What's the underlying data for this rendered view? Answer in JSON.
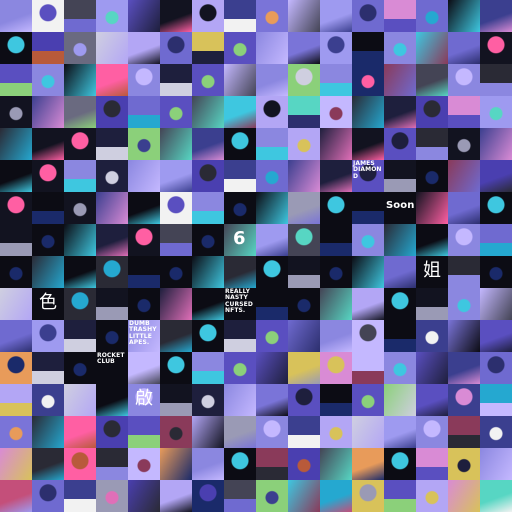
{
  "grid": {
    "cols": 16,
    "rows": 16
  },
  "palette": [
    "#8b87e0",
    "#6f6ad0",
    "#9e9af0",
    "#5a4fc0",
    "#b3a6f5",
    "#7a74d8",
    "#4a3fb0",
    "#c4b8ff",
    "#2c2f6e",
    "#3b3f8f",
    "#1e1f3d",
    "#121320",
    "#0c0c14",
    "#2a2a35",
    "#444455",
    "#6a6a80",
    "#d98bd5",
    "#e06fb8",
    "#ff5fa3",
    "#3ec7e0",
    "#25a8d0",
    "#57d6c3",
    "#8bd07a",
    "#d8c25a",
    "#e89b5a",
    "#b85a3a",
    "#8a3a5a",
    "#c44f7a",
    "#f2f2f2",
    "#cfcfe0",
    "#9a9ab5",
    "#1a2a6a"
  ],
  "tiles": [
    [
      0,
      28,
      14,
      2,
      3,
      11,
      4,
      9,
      5,
      7,
      2,
      1,
      16,
      1,
      12,
      9
    ],
    [
      12,
      6,
      15,
      29,
      4,
      1,
      23,
      3,
      0,
      5,
      2,
      12,
      0,
      19,
      1,
      11
    ],
    [
      3,
      0,
      12,
      18,
      0,
      10,
      3,
      7,
      0,
      22,
      0,
      31,
      26,
      14,
      0,
      13
    ],
    [
      11,
      9,
      15,
      6,
      1,
      3,
      14,
      19,
      4,
      21,
      7,
      13,
      10,
      6,
      16,
      2
    ],
    [
      13,
      11,
      11,
      10,
      22,
      14,
      9,
      12,
      0,
      4,
      10,
      11,
      3,
      13,
      11,
      9
    ],
    [
      12,
      11,
      0,
      10,
      0,
      2,
      6,
      9,
      1,
      9,
      10,
      3,
      11,
      12,
      26,
      6
    ],
    [
      11,
      12,
      11,
      9,
      12,
      28,
      0,
      12,
      12,
      30,
      12,
      12,
      12,
      11,
      1,
      12
    ],
    [
      11,
      12,
      12,
      10,
      11,
      14,
      12,
      14,
      2,
      14,
      12,
      0,
      13,
      12,
      0,
      1
    ],
    [
      12,
      13,
      12,
      13,
      12,
      12,
      12,
      13,
      12,
      11,
      12,
      12,
      1,
      12,
      13,
      12
    ],
    [
      29,
      12,
      13,
      11,
      12,
      10,
      12,
      13,
      12,
      12,
      14,
      4,
      12,
      11,
      0,
      7
    ],
    [
      1,
      2,
      10,
      12,
      0,
      13,
      12,
      10,
      3,
      1,
      0,
      7,
      12,
      9,
      5,
      3
    ],
    [
      24,
      10,
      12,
      11,
      7,
      12,
      0,
      3,
      3,
      23,
      16,
      7,
      0,
      3,
      9,
      1
    ],
    [
      4,
      9,
      29,
      12,
      0,
      11,
      10,
      0,
      5,
      3,
      12,
      3,
      22,
      3,
      9,
      20
    ],
    [
      5,
      13,
      18,
      6,
      3,
      26,
      4,
      30,
      0,
      9,
      4,
      29,
      2,
      0,
      26,
      9
    ],
    [
      16,
      13,
      18,
      13,
      7,
      24,
      0,
      12,
      26,
      6,
      14,
      24,
      12,
      16,
      23,
      0
    ],
    [
      27,
      1,
      9,
      30,
      6,
      4,
      31,
      14,
      22,
      19,
      20,
      23,
      3,
      4,
      16,
      21
    ]
  ],
  "labels": [
    {
      "id": "james-diamond",
      "text": "JAMES DIAMOND",
      "style": "normal",
      "row": 5,
      "col": 11
    },
    {
      "id": "soon",
      "text": "Soon",
      "style": "big",
      "row": 6,
      "col": 12
    },
    {
      "id": "six",
      "text": "6",
      "style": "digit",
      "row": 7,
      "col": 7
    },
    {
      "id": "really-nasty",
      "text": "REALLY NASTY CURSED NFTS.",
      "style": "normal",
      "row": 9,
      "col": 7
    },
    {
      "id": "dumb-trashy",
      "text": "DUMB TRASHY LITTLE APES.",
      "style": "normal",
      "row": 10,
      "col": 4
    },
    {
      "id": "rocket-club",
      "text": "ROCKET CLUB",
      "style": "normal",
      "row": 11,
      "col": 3
    },
    {
      "id": "cjk-color",
      "text": "色",
      "style": "cjk",
      "row": 9,
      "col": 1
    },
    {
      "id": "cjk-open",
      "text": "啟",
      "style": "cjk",
      "row": 12,
      "col": 4
    },
    {
      "id": "cjk-sister",
      "text": "姐",
      "style": "cjk",
      "row": 8,
      "col": 13
    }
  ]
}
